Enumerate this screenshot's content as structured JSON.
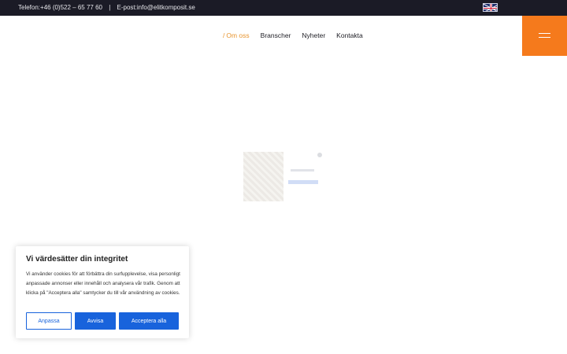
{
  "topbar": {
    "phone": "Telefon:+46 (0)522 – 65 77 60",
    "separator": "|",
    "email": "E-post:info@elitkomposit.se",
    "language_flag": "uk-flag-icon"
  },
  "nav": {
    "items": [
      {
        "label": "Om oss",
        "active": true
      },
      {
        "label": "Branscher"
      },
      {
        "label": "Nyheter"
      },
      {
        "label": "Kontakta"
      }
    ],
    "active_marker": "/"
  },
  "menu_button": {
    "icon": "hamburger-menu-icon",
    "color": "#f57a1c"
  },
  "cookie_banner": {
    "title": "Vi värdesätter din integritet",
    "body": "Vi använder cookies för att förbättra din surfupplevelse, visa personligt anpassade annonser eller innehåll och analysera vår trafik. Genom att klicka på \"Acceptera alla\" samtycker du till vår användning av cookies.",
    "buttons": {
      "customize": "Anpassa",
      "reject": "Avvisa",
      "accept": "Acceptera alla"
    },
    "accent": "#1863dc"
  },
  "colors": {
    "topbar_bg": "#1b1b26",
    "nav_active": "#e8952f"
  }
}
